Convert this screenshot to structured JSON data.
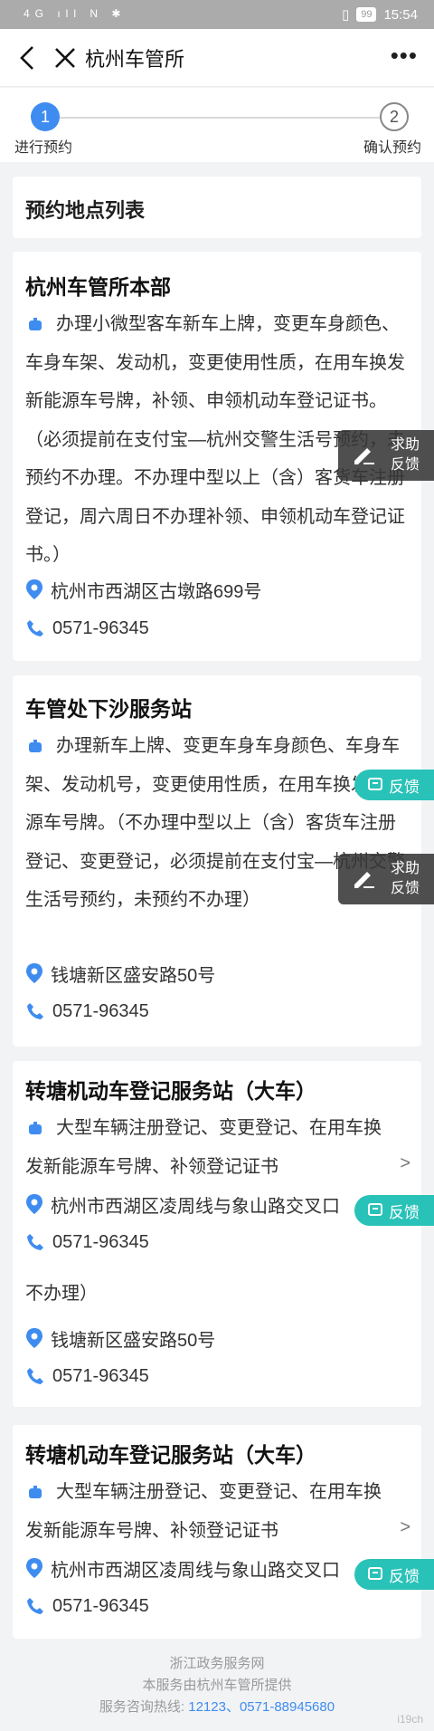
{
  "status": {
    "left": "4G ıll N ✱",
    "battery": "99",
    "time": "15:54"
  },
  "titlebar": {
    "title": "杭州车管所",
    "more": "•••"
  },
  "steps": {
    "s1_num": "1",
    "s1_label": "进行预约",
    "s2_num": "2",
    "s2_label": "确认预约"
  },
  "list_title": "预约地点列表",
  "locations": [
    {
      "name": "杭州车管所本部",
      "desc": "办理小微型客车新车上牌，变更车身颜色、车身车架、发动机，变更使用性质，在用车换发新能源车号牌，补领、申领机动车登记证书。（必须提前在支付宝—杭州交警生活号预约，未预约不办理。不办理中型以上（含）客货车注册登记，周六周日不办理补领、申领机动车登记证书。）",
      "address": "杭州市西湖区古墩路699号",
      "phone": "0571-96345"
    },
    {
      "name": "车管处下沙服务站",
      "desc": "办理新车上牌、变更车身车身颜色、车身车架、发动机号，变更使用性质，在用车换发新能源车号牌。（不办理中型以上（含）客货车注册登记、变更登记，必须提前在支付宝—杭州交警生活号预约，未预约不办理）",
      "address": "钱塘新区盛安路50号",
      "phone": "0571-96345"
    },
    {
      "name": "转塘机动车登记服务站（大车）",
      "desc": "大型车辆注册登记、变更登记、在用车换发新能源车号牌、补领登记证书",
      "address": "杭州市西湖区凌周线与象山路交叉口",
      "phone": "0571-96345"
    },
    {
      "name": "转塘机动车登记服务站（大车）",
      "desc": "大型车辆注册登记、变更登记、在用车换发新能源车号牌、补领登记证书",
      "address": "杭州市西湖区凌周线与象山路交叉口",
      "phone": "0571-96345"
    }
  ],
  "glitch": {
    "line2": "不办理）",
    "address": "钱塘新区盛安路50号",
    "phone": "0571-96345"
  },
  "arrow": ">",
  "help_label_1": "求助",
  "help_label_2": "反馈",
  "feedback_label": "反馈",
  "footer": {
    "line1": "浙江政务服务网",
    "line2": "本服务由杭州车管所提供",
    "line3_prefix": "服务咨询热线: ",
    "line3_links": "12123、0571-88945680"
  },
  "watermark": "i19ch",
  "colors": {
    "accent": "#3f8cf0",
    "feedback": "#29c2b8",
    "help_bg": "#373737"
  }
}
